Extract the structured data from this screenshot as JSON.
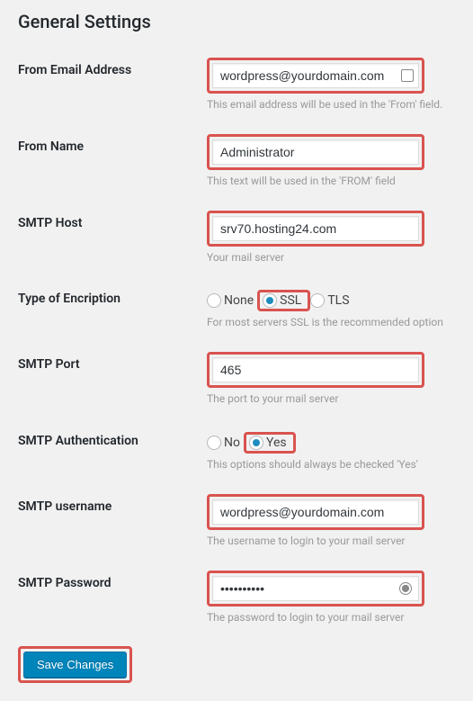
{
  "title": "General Settings",
  "fields": {
    "from_email": {
      "label": "From Email Address",
      "value": "wordpress@yourdomain.com",
      "help": "This email address will be used in the 'From' field."
    },
    "from_name": {
      "label": "From Name",
      "value": "Administrator",
      "help": "This text will be used in the 'FROM' field"
    },
    "smtp_host": {
      "label": "SMTP Host",
      "value": "srv70.hosting24.com",
      "help": "Your mail server"
    },
    "encription": {
      "label": "Type of Encription",
      "options": {
        "none": "None",
        "ssl": "SSL",
        "tls": "TLS"
      },
      "selected": "ssl",
      "help": "For most servers SSL is the recommended option"
    },
    "smtp_port": {
      "label": "SMTP Port",
      "value": "465",
      "help": "The port to your mail server"
    },
    "smtp_auth": {
      "label": "SMTP Authentication",
      "options": {
        "no": "No",
        "yes": "Yes"
      },
      "selected": "yes",
      "help": "This options should always be checked 'Yes'"
    },
    "smtp_username": {
      "label": "SMTP username",
      "value": "wordpress@yourdomain.com",
      "help": "The username to login to your mail server"
    },
    "smtp_password": {
      "label": "SMTP Password",
      "value": "••••••••••",
      "help": "The password to login to your mail server"
    }
  },
  "submit": {
    "label": "Save Changes"
  }
}
